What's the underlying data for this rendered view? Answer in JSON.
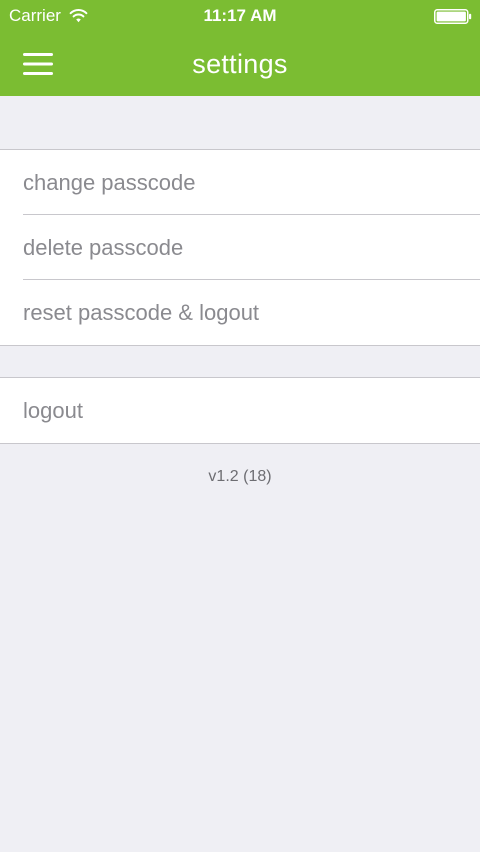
{
  "status_bar": {
    "carrier": "Carrier",
    "time": "11:17 AM",
    "wifi_icon": "wifi-icon",
    "battery_icon": "battery-icon"
  },
  "nav_bar": {
    "title": "settings",
    "menu_icon": "hamburger-menu-icon",
    "background_color": "#7bbd32"
  },
  "settings": {
    "passcode_group": [
      {
        "label": "change passcode"
      },
      {
        "label": "delete passcode"
      },
      {
        "label": "reset passcode & logout"
      }
    ],
    "account_group": [
      {
        "label": "logout"
      }
    ]
  },
  "footer": {
    "version": "v1.2 (18)"
  },
  "colors": {
    "accent": "#7bbd32",
    "background": "#efeff4",
    "row_text": "#8a8a8f",
    "separator": "#c8c7cc"
  }
}
